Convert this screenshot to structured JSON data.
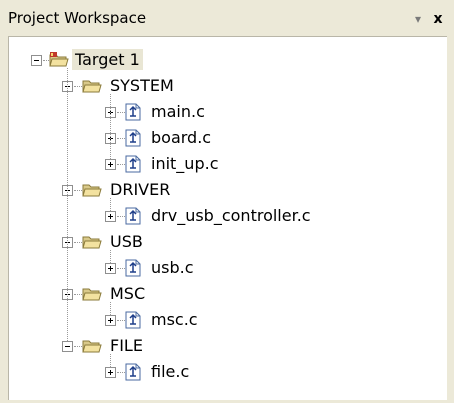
{
  "window": {
    "title": "Project Workspace",
    "dropdown_glyph": "▾",
    "close_glyph": "x"
  },
  "tree": {
    "root": {
      "label": "Target 1",
      "icon": "target-folder-icon"
    },
    "groups": [
      {
        "label": "SYSTEM",
        "icon": "folder-icon",
        "files": [
          "main.c",
          "board.c",
          "init_up.c"
        ]
      },
      {
        "label": "DRIVER",
        "icon": "folder-icon",
        "files": [
          "drv_usb_controller.c"
        ]
      },
      {
        "label": "USB",
        "icon": "folder-icon",
        "files": [
          "usb.c"
        ]
      },
      {
        "label": "MSC",
        "icon": "folder-icon",
        "files": [
          "msc.c"
        ]
      },
      {
        "label": "FILE",
        "icon": "folder-icon",
        "files": [
          "file.c"
        ]
      }
    ],
    "file_icon": "c-source-file-icon"
  }
}
